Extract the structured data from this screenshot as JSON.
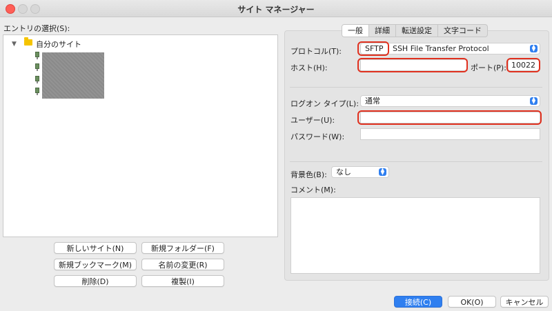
{
  "window": {
    "title": "サイト マネージャー"
  },
  "tree": {
    "label": "エントリの選択(S):",
    "root": "自分のサイト"
  },
  "left_buttons": {
    "new_site": "新しいサイト(N)",
    "new_folder": "新規フォルダー(F)",
    "new_bookmark": "新規ブックマーク(M)",
    "rename": "名前の変更(R)",
    "delete": "削除(D)",
    "duplicate": "複製(I)"
  },
  "tabs": [
    {
      "label": "一般"
    },
    {
      "label": "詳細"
    },
    {
      "label": "転送設定"
    },
    {
      "label": "文字コード"
    }
  ],
  "form": {
    "protocol_label": "プロトコル(T):",
    "protocol_value": "SFTP",
    "protocol_name": "SSH File Transfer Protocol",
    "host_label": "ホスト(H):",
    "host_value": "",
    "port_label": "ポート(P):",
    "port_value": "10022",
    "logon_type_label": "ログオン タイプ(L):",
    "logon_type_value": "通常",
    "user_label": "ユーザー(U):",
    "user_value": "",
    "password_label": "パスワード(W):",
    "password_value": "",
    "bg_color_label": "背景色(B):",
    "bg_color_value": "なし",
    "comment_label": "コメント(M):"
  },
  "bottom_buttons": {
    "connect": "接続(C)",
    "ok": "OK(O)",
    "cancel": "キャンセル"
  },
  "colors": {
    "accent": "#2f7ff0",
    "highlight": "#e0301e"
  }
}
